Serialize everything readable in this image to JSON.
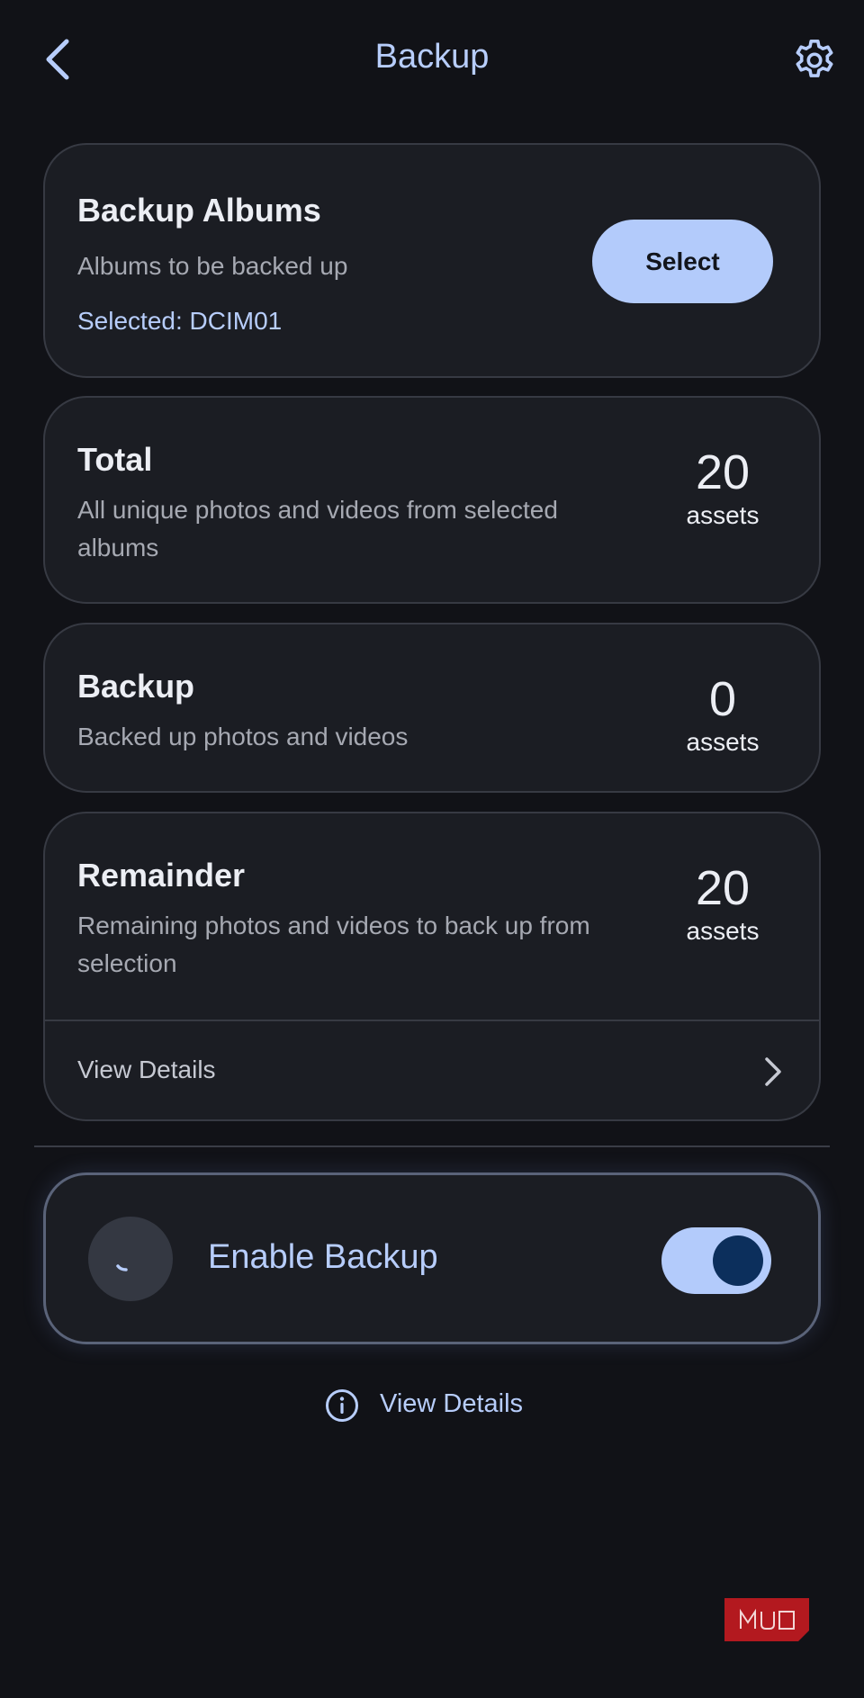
{
  "header": {
    "title": "Backup",
    "back_icon": "chevron-left-icon",
    "settings_icon": "gear-icon"
  },
  "albums_card": {
    "title": "Backup Albums",
    "subtitle": "Albums to be backed up",
    "selected": "Selected: DCIM01",
    "select_label": "Select"
  },
  "total_card": {
    "title": "Total",
    "subtitle": "All unique photos and videos from selected albums",
    "count": "20",
    "unit": "assets"
  },
  "backup_card": {
    "title": "Backup",
    "subtitle": "Backed up photos and videos",
    "count": "0",
    "unit": "assets"
  },
  "remainder_card": {
    "title": "Remainder",
    "subtitle": "Remaining photos and videos to back up from selection",
    "count": "20",
    "unit": "assets",
    "view_details": "View Details"
  },
  "enable_card": {
    "label": "Enable Backup",
    "toggle_on": true
  },
  "bottom_link": {
    "label": "View Details",
    "icon": "info-icon"
  },
  "watermark": {
    "text": "MUO"
  },
  "colors": {
    "background": "#111217",
    "card": "#1b1d23",
    "accent": "#b7cdfb",
    "button": "#b3cbfb",
    "toggle_knob": "#0c2f5c",
    "watermark": "#b3191f"
  }
}
